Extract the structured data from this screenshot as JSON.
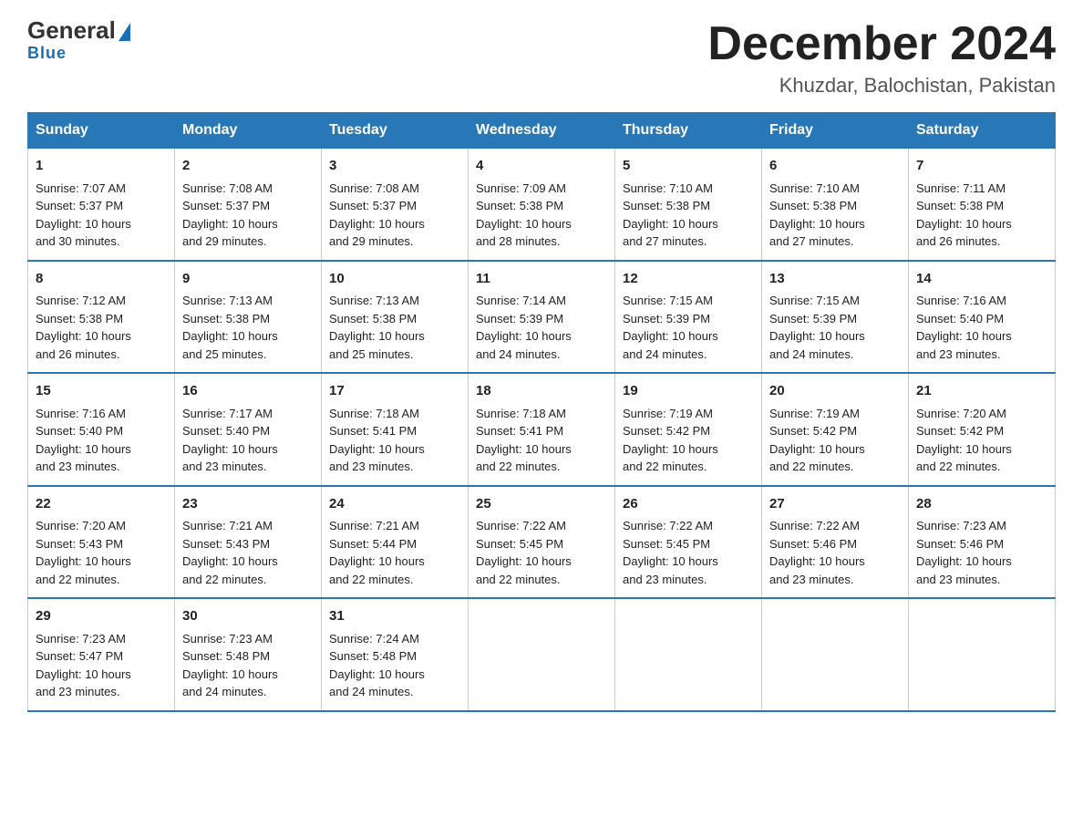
{
  "logo": {
    "general": "General",
    "triangle": "▶",
    "blue": "Blue"
  },
  "header": {
    "month": "December 2024",
    "location": "Khuzdar, Balochistan, Pakistan"
  },
  "days": [
    "Sunday",
    "Monday",
    "Tuesday",
    "Wednesday",
    "Thursday",
    "Friday",
    "Saturday"
  ],
  "weeks": [
    [
      {
        "day": "1",
        "sunrise": "7:07 AM",
        "sunset": "5:37 PM",
        "daylight": "10 hours and 30 minutes."
      },
      {
        "day": "2",
        "sunrise": "7:08 AM",
        "sunset": "5:37 PM",
        "daylight": "10 hours and 29 minutes."
      },
      {
        "day": "3",
        "sunrise": "7:08 AM",
        "sunset": "5:37 PM",
        "daylight": "10 hours and 29 minutes."
      },
      {
        "day": "4",
        "sunrise": "7:09 AM",
        "sunset": "5:38 PM",
        "daylight": "10 hours and 28 minutes."
      },
      {
        "day": "5",
        "sunrise": "7:10 AM",
        "sunset": "5:38 PM",
        "daylight": "10 hours and 27 minutes."
      },
      {
        "day": "6",
        "sunrise": "7:10 AM",
        "sunset": "5:38 PM",
        "daylight": "10 hours and 27 minutes."
      },
      {
        "day": "7",
        "sunrise": "7:11 AM",
        "sunset": "5:38 PM",
        "daylight": "10 hours and 26 minutes."
      }
    ],
    [
      {
        "day": "8",
        "sunrise": "7:12 AM",
        "sunset": "5:38 PM",
        "daylight": "10 hours and 26 minutes."
      },
      {
        "day": "9",
        "sunrise": "7:13 AM",
        "sunset": "5:38 PM",
        "daylight": "10 hours and 25 minutes."
      },
      {
        "day": "10",
        "sunrise": "7:13 AM",
        "sunset": "5:38 PM",
        "daylight": "10 hours and 25 minutes."
      },
      {
        "day": "11",
        "sunrise": "7:14 AM",
        "sunset": "5:39 PM",
        "daylight": "10 hours and 24 minutes."
      },
      {
        "day": "12",
        "sunrise": "7:15 AM",
        "sunset": "5:39 PM",
        "daylight": "10 hours and 24 minutes."
      },
      {
        "day": "13",
        "sunrise": "7:15 AM",
        "sunset": "5:39 PM",
        "daylight": "10 hours and 24 minutes."
      },
      {
        "day": "14",
        "sunrise": "7:16 AM",
        "sunset": "5:40 PM",
        "daylight": "10 hours and 23 minutes."
      }
    ],
    [
      {
        "day": "15",
        "sunrise": "7:16 AM",
        "sunset": "5:40 PM",
        "daylight": "10 hours and 23 minutes."
      },
      {
        "day": "16",
        "sunrise": "7:17 AM",
        "sunset": "5:40 PM",
        "daylight": "10 hours and 23 minutes."
      },
      {
        "day": "17",
        "sunrise": "7:18 AM",
        "sunset": "5:41 PM",
        "daylight": "10 hours and 23 minutes."
      },
      {
        "day": "18",
        "sunrise": "7:18 AM",
        "sunset": "5:41 PM",
        "daylight": "10 hours and 22 minutes."
      },
      {
        "day": "19",
        "sunrise": "7:19 AM",
        "sunset": "5:42 PM",
        "daylight": "10 hours and 22 minutes."
      },
      {
        "day": "20",
        "sunrise": "7:19 AM",
        "sunset": "5:42 PM",
        "daylight": "10 hours and 22 minutes."
      },
      {
        "day": "21",
        "sunrise": "7:20 AM",
        "sunset": "5:42 PM",
        "daylight": "10 hours and 22 minutes."
      }
    ],
    [
      {
        "day": "22",
        "sunrise": "7:20 AM",
        "sunset": "5:43 PM",
        "daylight": "10 hours and 22 minutes."
      },
      {
        "day": "23",
        "sunrise": "7:21 AM",
        "sunset": "5:43 PM",
        "daylight": "10 hours and 22 minutes."
      },
      {
        "day": "24",
        "sunrise": "7:21 AM",
        "sunset": "5:44 PM",
        "daylight": "10 hours and 22 minutes."
      },
      {
        "day": "25",
        "sunrise": "7:22 AM",
        "sunset": "5:45 PM",
        "daylight": "10 hours and 22 minutes."
      },
      {
        "day": "26",
        "sunrise": "7:22 AM",
        "sunset": "5:45 PM",
        "daylight": "10 hours and 23 minutes."
      },
      {
        "day": "27",
        "sunrise": "7:22 AM",
        "sunset": "5:46 PM",
        "daylight": "10 hours and 23 minutes."
      },
      {
        "day": "28",
        "sunrise": "7:23 AM",
        "sunset": "5:46 PM",
        "daylight": "10 hours and 23 minutes."
      }
    ],
    [
      {
        "day": "29",
        "sunrise": "7:23 AM",
        "sunset": "5:47 PM",
        "daylight": "10 hours and 23 minutes."
      },
      {
        "day": "30",
        "sunrise": "7:23 AM",
        "sunset": "5:48 PM",
        "daylight": "10 hours and 24 minutes."
      },
      {
        "day": "31",
        "sunrise": "7:24 AM",
        "sunset": "5:48 PM",
        "daylight": "10 hours and 24 minutes."
      },
      null,
      null,
      null,
      null
    ]
  ],
  "labels": {
    "sunrise": "Sunrise:",
    "sunset": "Sunset:",
    "daylight": "Daylight:"
  }
}
